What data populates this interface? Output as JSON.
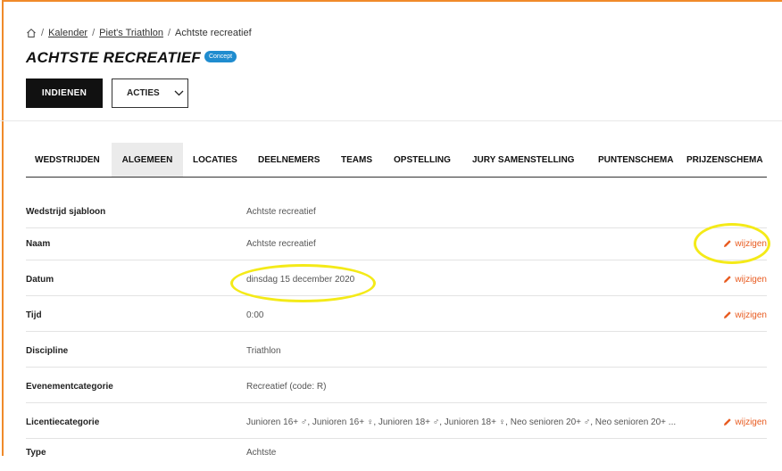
{
  "breadcrumb": {
    "home_icon": "home-icon",
    "items": [
      "Kalender",
      "Piet's Triathlon"
    ],
    "current": "Achtste recreatief",
    "separator": "/"
  },
  "page": {
    "title": "ACHTSTE RECREATIEF",
    "status_badge": "Concept"
  },
  "toolbar": {
    "submit_label": "INDIENEN",
    "actions_label": "ACTIES"
  },
  "tabs": [
    {
      "label": "WEDSTRIJDEN",
      "active": false
    },
    {
      "label": "ALGEMEEN",
      "active": true
    },
    {
      "label": "LOCATIES",
      "active": false
    },
    {
      "label": "DEELNEMERS",
      "active": false
    },
    {
      "label": "TEAMS",
      "active": false
    },
    {
      "label": "OPSTELLING",
      "active": false
    },
    {
      "label": "JURY SAMENSTELLING",
      "active": false
    },
    {
      "label": "PUNTENSCHEMA",
      "active": false
    },
    {
      "label": "PRIJZENSCHEMA",
      "active": false
    }
  ],
  "details": {
    "edit_label": "wijzigen",
    "rows": [
      {
        "label": "Wedstrijd sjabloon",
        "value": "Achtste recreatief",
        "editable": false
      },
      {
        "label": "Naam",
        "value": "Achtste recreatief",
        "editable": true
      },
      {
        "label": "Datum",
        "value": "dinsdag 15 december 2020",
        "editable": true
      },
      {
        "label": "Tijd",
        "value": "0:00",
        "editable": true
      },
      {
        "label": "Discipline",
        "value": "Triathlon",
        "editable": false
      },
      {
        "label": "Evenementcategorie",
        "value": "Recreatief (code: R)",
        "editable": false
      },
      {
        "label": "Licentiecategorie",
        "value": "Junioren 16+ ♂, Junioren 16+ ♀, Junioren 18+ ♂, Junioren 18+ ♀, Neo senioren 20+ ♂, Neo senioren 20+ ...",
        "editable": true
      },
      {
        "label": "Type",
        "value": "Achtste",
        "editable": false
      }
    ]
  },
  "colors": {
    "accent": "#e85b20",
    "badge": "#1f8ccf",
    "frame": "#f08a2a",
    "highlight": "#f4ea18"
  }
}
